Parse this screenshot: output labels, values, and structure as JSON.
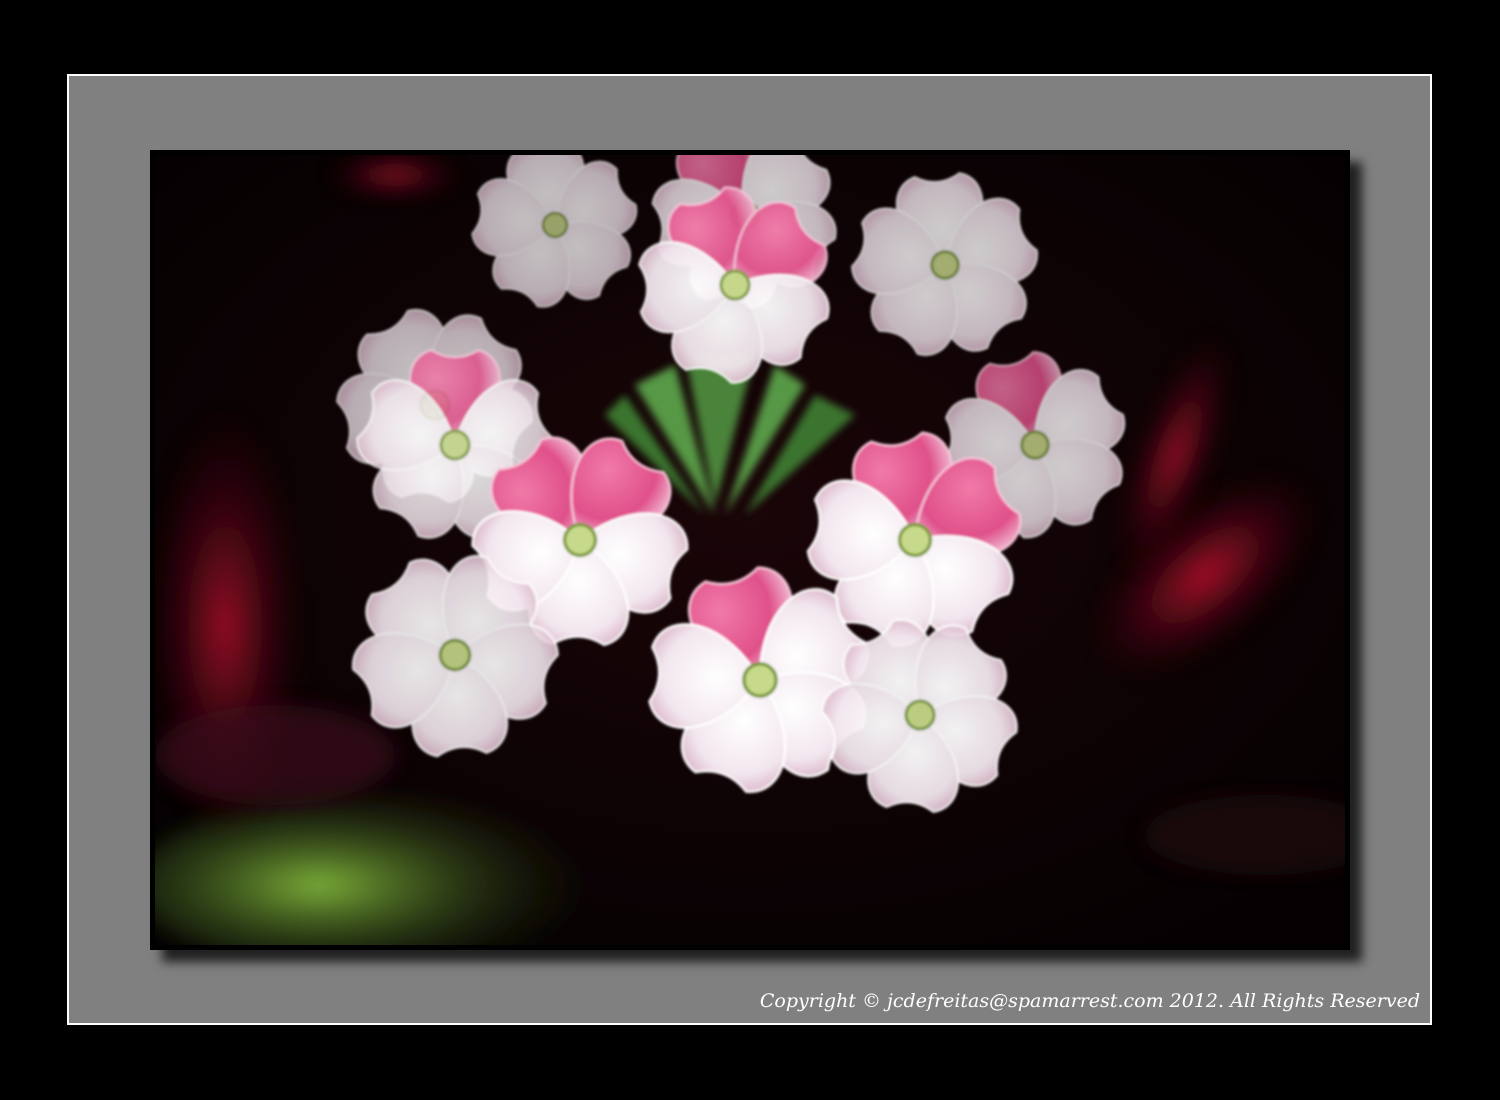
{
  "colors": {
    "outer_background": "#000000",
    "mat": "#808080",
    "mat_border": "#ffffff",
    "petal_pink": "#e0508a",
    "petal_white": "#f4eef2",
    "stem_green": "#5a9a4a",
    "background_red": "#b0102a"
  },
  "subject": {
    "icon": "verbena-flower-cluster"
  },
  "watermark": {
    "copyright_text": "Copyright © jcdefreitas@spamarrest.com 2012. All Rights Reserved"
  }
}
